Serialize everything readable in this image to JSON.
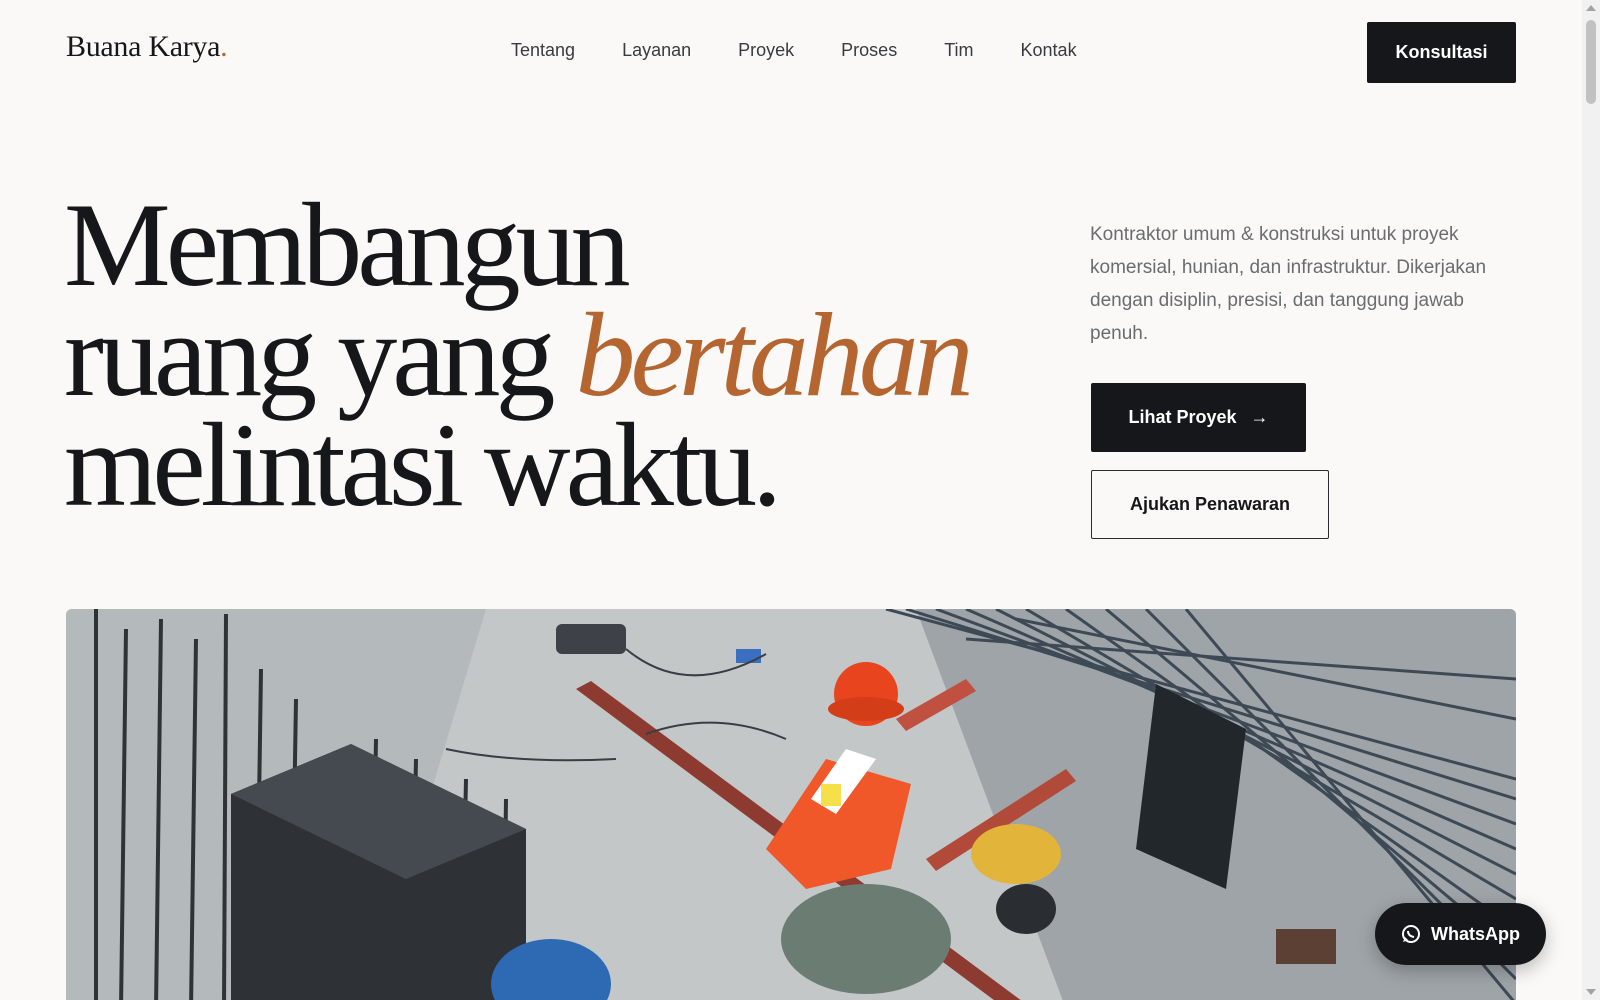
{
  "header": {
    "logo_text": "Buana Karya",
    "logo_dot": ".",
    "nav": [
      "Tentang",
      "Layanan",
      "Proyek",
      "Proses",
      "Tim",
      "Kontak"
    ],
    "cta_label": "Konsultasi"
  },
  "hero": {
    "line1": "Membangun",
    "line2_prefix": "ruang yang ",
    "line2_accent": "bertahan",
    "line3": "melintasi waktu.",
    "description": "Kontraktor umum & konstruksi untuk proyek komersial, hunian, dan infrastruktur. Dikerjakan dengan disiplin, presisi, dan tanggung jawab penuh.",
    "primary_button": "Lihat Proyek",
    "primary_arrow": "→",
    "secondary_button": "Ajukan Penawaran"
  },
  "image": {
    "subject": "construction-worker-on-site"
  },
  "whatsapp": {
    "label": "WhatsApp",
    "icon": "whatsapp-icon"
  },
  "colors": {
    "accent": "#b5652f",
    "dark": "#16171a",
    "background": "#faf9f7"
  }
}
